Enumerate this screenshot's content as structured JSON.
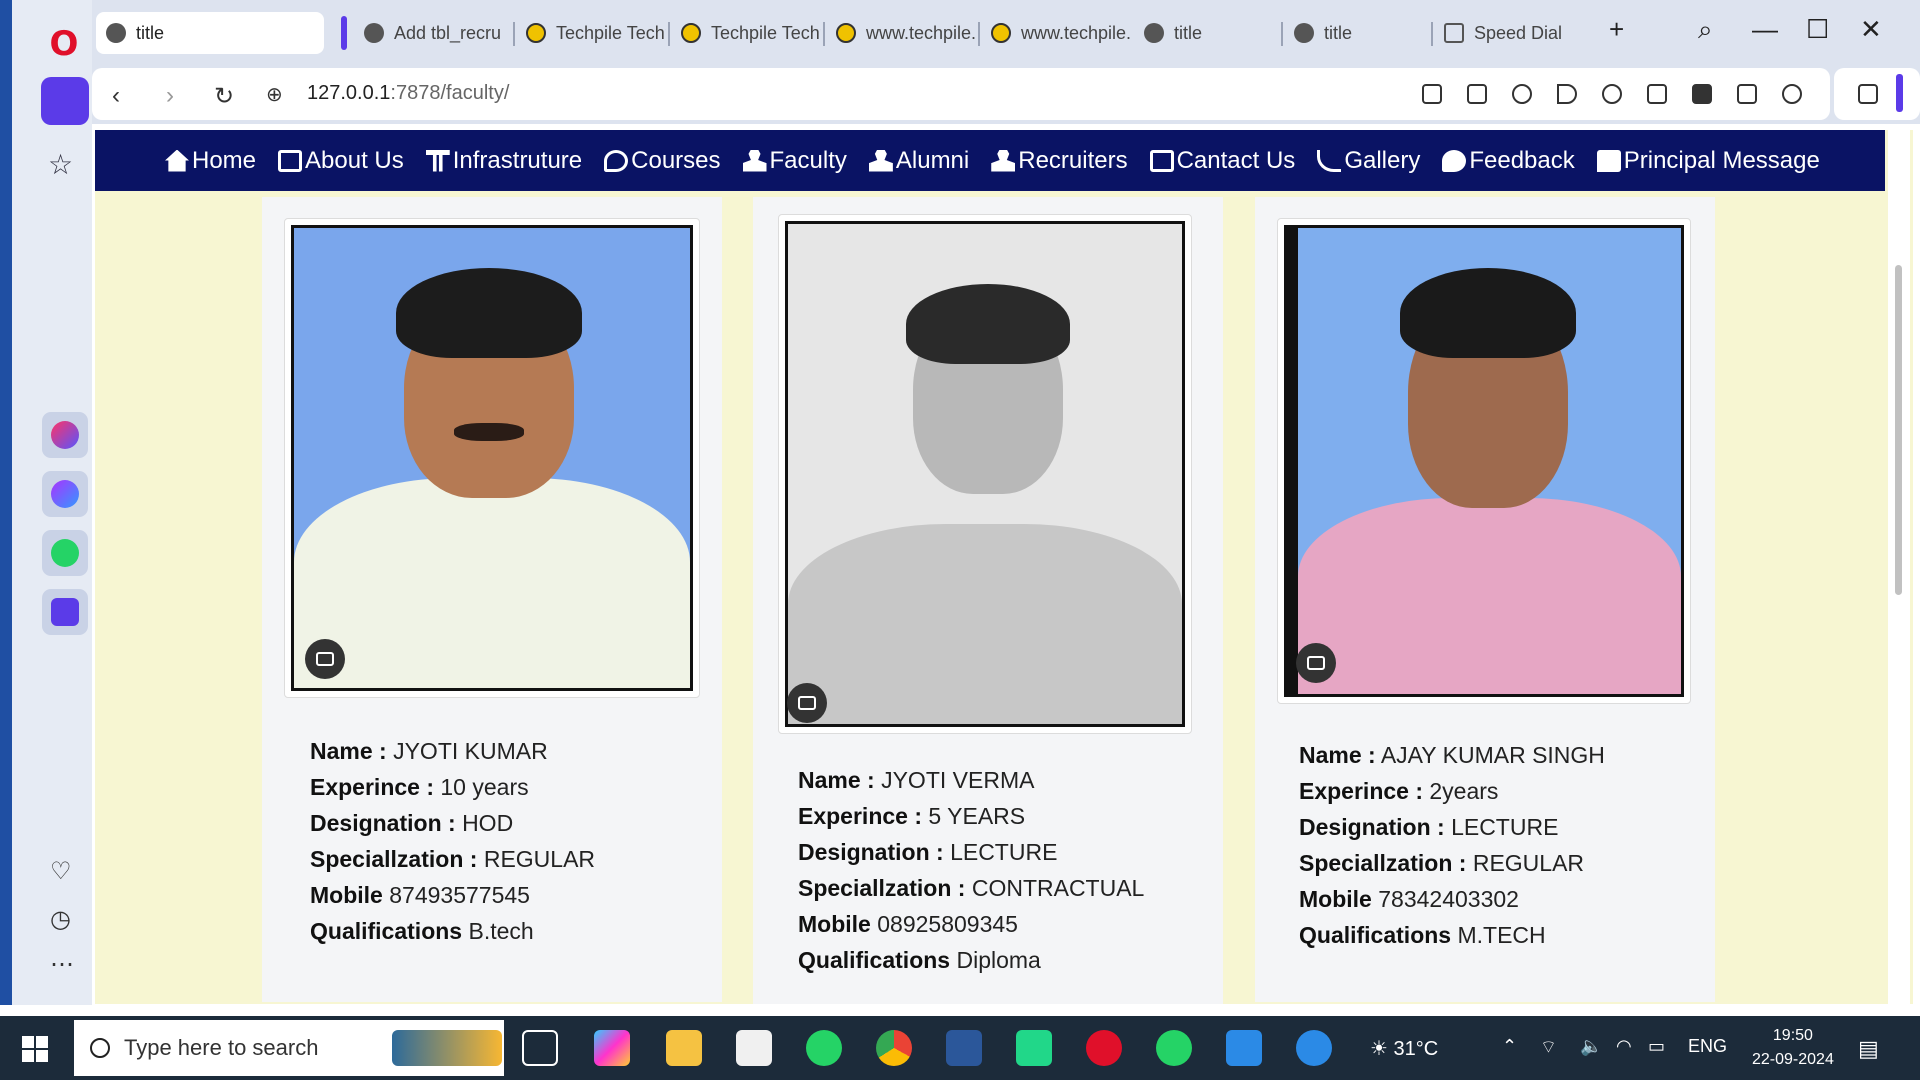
{
  "browser": {
    "tabs": [
      {
        "label": "title",
        "icon": "globe-icon"
      },
      {
        "label": "Add tbl_recru",
        "icon": "globe-icon"
      },
      {
        "label": "Techpile Techr",
        "icon": "techpile-icon"
      },
      {
        "label": "Techpile Techr",
        "icon": "techpile-icon"
      },
      {
        "label": "www.techpile.",
        "icon": "techpile-icon"
      },
      {
        "label": "www.techpile.",
        "icon": "techpile-icon"
      },
      {
        "label": "title",
        "icon": "globe-icon"
      },
      {
        "label": "title",
        "icon": "globe-icon"
      },
      {
        "label": "Speed Dial",
        "icon": "grid-icon"
      }
    ],
    "url_host": "127.0.0.1",
    "url_path": ":7878/faculty/"
  },
  "nav": {
    "items": [
      "Home",
      "About Us",
      "Infrastruture",
      "Courses",
      "Faculty",
      "Alumni",
      "Recruiters",
      "Cantact Us",
      "Gallery",
      "Feedback",
      "Principal Message"
    ]
  },
  "labels": {
    "name": "Name :",
    "experience": "Experince :",
    "designation": "Designation :",
    "specialization": "Speciallzation :",
    "mobile": "Mobile",
    "qualifications": "Qualifications"
  },
  "faculty": [
    {
      "name": "JYOTI KUMAR",
      "experience": "10 years",
      "designation": "HOD",
      "specialization": "REGULAR",
      "mobile": "87493577545",
      "qualifications": "B.tech"
    },
    {
      "name": "JYOTI VERMA",
      "experience": "5 YEARS",
      "designation": "LECTURE",
      "specialization": "CONTRACTUAL",
      "mobile": "08925809345",
      "qualifications": "Diploma"
    },
    {
      "name": "AJAY KUMAR SINGH",
      "experience": "2years",
      "designation": "LECTURE",
      "specialization": "REGULAR",
      "mobile": "78342403302",
      "qualifications": "M.TECH"
    }
  ],
  "taskbar": {
    "search_placeholder": "Type here to search",
    "temperature": "31°C",
    "language": "ENG",
    "time": "19:50",
    "date": "22-09-2024"
  },
  "colors": {
    "navbar": "#0a1364",
    "page_bg": "#f7f6d2",
    "opera_accent": "#5b3be8"
  }
}
